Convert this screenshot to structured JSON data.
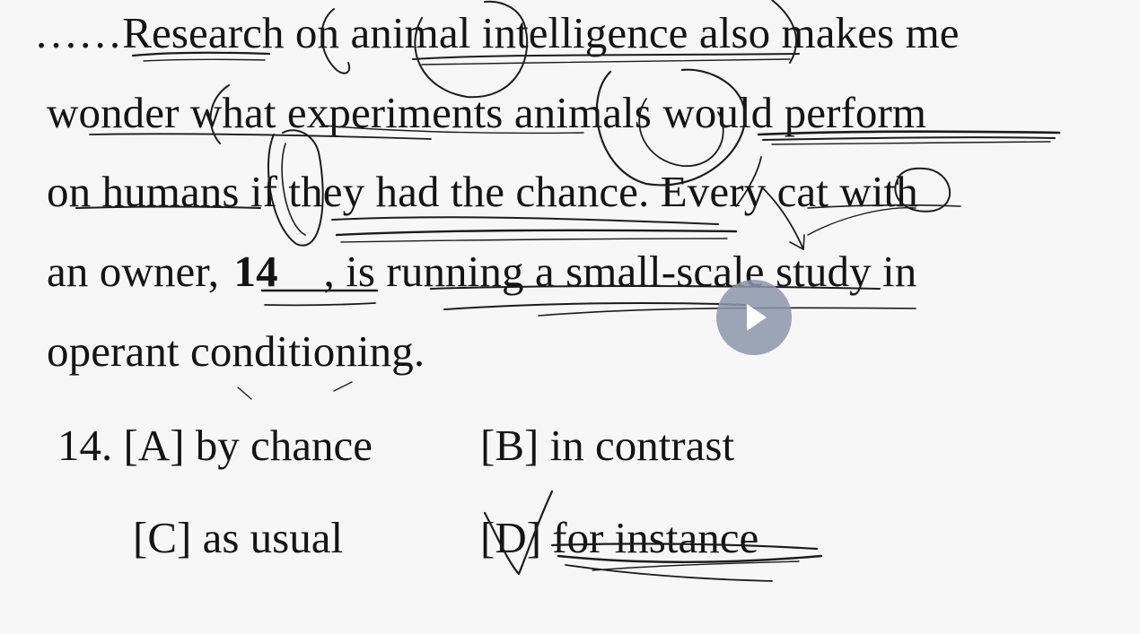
{
  "passage": {
    "line1": "……Research on animal intelligence also makes me",
    "line2": "wonder what experiments animals would perform",
    "line3": "on humans if they had the chance. Every cat with",
    "line4_pre": "an owner, ",
    "blank_number": "14",
    "line4_post": ", is running a small-scale study in",
    "line5": "operant conditioning."
  },
  "question": {
    "number": "14.",
    "options": [
      {
        "key": "[A]",
        "text": "by chance"
      },
      {
        "key": "[B]",
        "text": "in contrast"
      },
      {
        "key": "[C]",
        "text": "as usual"
      },
      {
        "key": "[D]",
        "text": "for instance"
      }
    ]
  },
  "player": {
    "icon": "play-icon"
  },
  "colors": {
    "background": "#f7f7f7",
    "text": "#141414",
    "ink": "#1c1c1c",
    "play_button": "#8c96aa"
  }
}
